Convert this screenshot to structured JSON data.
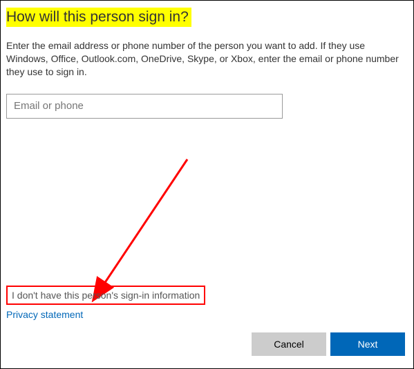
{
  "heading": "How will this person sign in?",
  "instruction": "Enter the email address or phone number of the person you want to add. If they use Windows, Office, Outlook.com, OneDrive, Skype, or Xbox, enter the email or phone number they use to sign in.",
  "input": {
    "placeholder": "Email or phone",
    "value": ""
  },
  "links": {
    "no_info": "I don't have this person's sign-in information",
    "privacy": "Privacy statement"
  },
  "buttons": {
    "cancel": "Cancel",
    "next": "Next"
  },
  "colors": {
    "highlight_bg": "#ffff00",
    "primary_button": "#0067b8",
    "secondary_button": "#cccccc",
    "link": "#0067b8",
    "annotation_red": "#ff0000"
  }
}
